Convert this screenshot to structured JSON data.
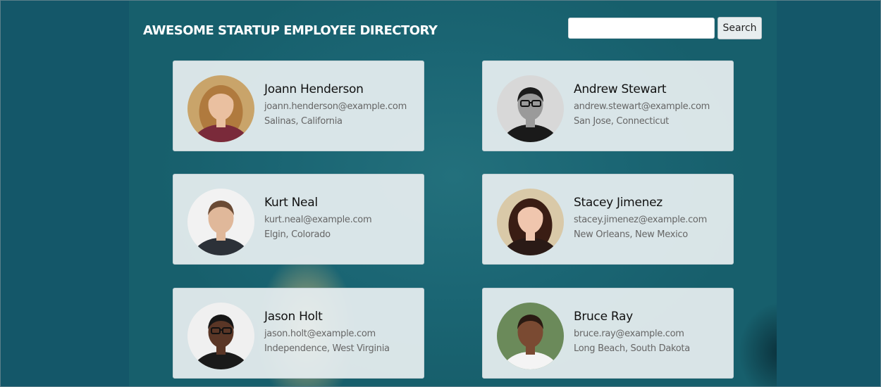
{
  "header": {
    "title": "AWESOME STARTUP EMPLOYEE DIRECTORY"
  },
  "search": {
    "value": "",
    "placeholder": "",
    "button_label": "Search"
  },
  "employees": [
    {
      "name": "Joann Henderson",
      "email": "joann.henderson@example.com",
      "location": "Salinas, California",
      "avatar_icon": "woman-curly-hair-avatar",
      "colors": {
        "bg": "#c9a46a",
        "hair": "#b07a3e",
        "skin": "#eac0a0",
        "shirt": "#7a2a3a"
      }
    },
    {
      "name": "Andrew Stewart",
      "email": "andrew.stewart@example.com",
      "location": "San Jose, Connecticut",
      "avatar_icon": "man-glasses-bw-avatar",
      "colors": {
        "bg": "#d8d8d8",
        "hair": "#1c1c1c",
        "skin": "#9a9a9a",
        "shirt": "#1a1a1a"
      }
    },
    {
      "name": "Kurt Neal",
      "email": "kurt.neal@example.com",
      "location": "Elgin, Colorado",
      "avatar_icon": "man-hoodie-avatar",
      "colors": {
        "bg": "#f2f2f2",
        "hair": "#6a4a34",
        "skin": "#e0b89a",
        "shirt": "#2c3138"
      }
    },
    {
      "name": "Stacey Jimenez",
      "email": "stacey.jimenez@example.com",
      "location": "New Orleans, New Mexico",
      "avatar_icon": "woman-dark-hair-avatar",
      "colors": {
        "bg": "#d9c9a8",
        "hair": "#3a1d14",
        "skin": "#f0c6ae",
        "shirt": "#2a1a16"
      }
    },
    {
      "name": "Jason Holt",
      "email": "jason.holt@example.com",
      "location": "Independence, West Virginia",
      "avatar_icon": "man-glasses-avatar",
      "colors": {
        "bg": "#f0f0f0",
        "hair": "#161616",
        "skin": "#5a3626",
        "shirt": "#1a1a1a"
      }
    },
    {
      "name": "Bruce Ray",
      "email": "bruce.ray@example.com",
      "location": "Long Beach, South Dakota",
      "avatar_icon": "man-white-shirt-avatar",
      "colors": {
        "bg": "#6b8a5a",
        "hair": "#2a1a12",
        "skin": "#7a4a32",
        "shirt": "#f4f4f4"
      }
    }
  ]
}
